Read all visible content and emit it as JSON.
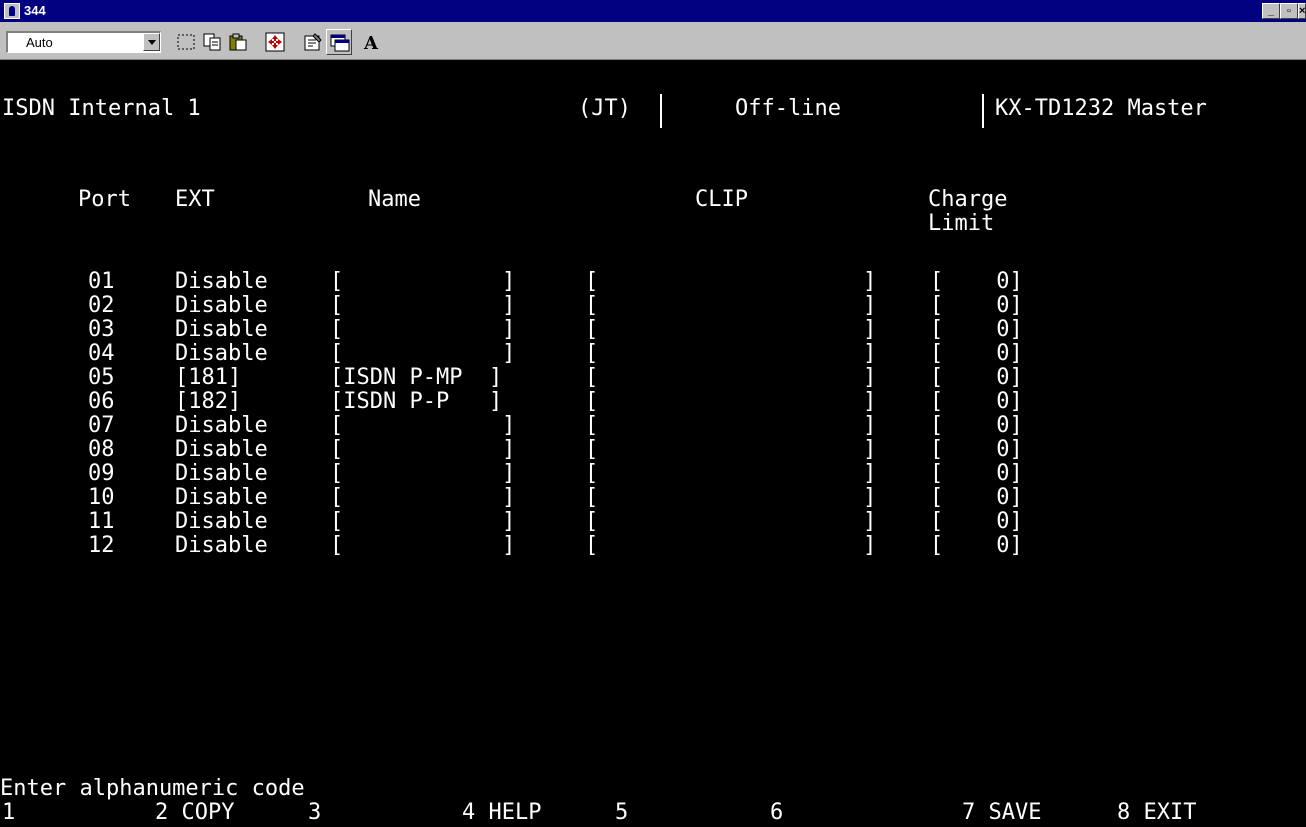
{
  "window": {
    "title": "344"
  },
  "toolbar": {
    "font_size_value": "Auto"
  },
  "header": {
    "screen_title": "ISDN Internal 1",
    "jt": "(JT)",
    "status": "Off-line",
    "model": "KX-TD1232 Master"
  },
  "columns": {
    "port": "Port",
    "ext": "EXT",
    "name": "Name",
    "clip": "CLIP",
    "charge": "Charge",
    "limit": "Limit"
  },
  "rows": [
    {
      "port": "01",
      "ext": "Disable",
      "name": "[            ]",
      "clip": "[                    ]",
      "charge": "[    0]"
    },
    {
      "port": "02",
      "ext": "Disable",
      "name": "[            ]",
      "clip": "[                    ]",
      "charge": "[    0]"
    },
    {
      "port": "03",
      "ext": "Disable",
      "name": "[            ]",
      "clip": "[                    ]",
      "charge": "[    0]"
    },
    {
      "port": "04",
      "ext": "Disable",
      "name": "[            ]",
      "clip": "[                    ]",
      "charge": "[    0]"
    },
    {
      "port": "05",
      "ext": "[181]",
      "name": "[ISDN P-MP  ]",
      "clip": "[                    ]",
      "charge": "[    0]"
    },
    {
      "port": "06",
      "ext": "[182]",
      "name": "[ISDN P-P   ]",
      "clip": "[                    ]",
      "charge": "[    0]"
    },
    {
      "port": "07",
      "ext": "Disable",
      "name": "[            ]",
      "clip": "[                    ]",
      "charge": "[    0]"
    },
    {
      "port": "08",
      "ext": "Disable",
      "name": "[            ]",
      "clip": "[                    ]",
      "charge": "[    0]"
    },
    {
      "port": "09",
      "ext": "Disable",
      "name": "[            ]",
      "clip": "[                    ]",
      "charge": "[    0]"
    },
    {
      "port": "10",
      "ext": "Disable",
      "name": "[            ]",
      "clip": "[                    ]",
      "charge": "[    0]"
    },
    {
      "port": "11",
      "ext": "Disable",
      "name": "[            ]",
      "clip": "[                    ]",
      "charge": "[    0]"
    },
    {
      "port": "12",
      "ext": "Disable",
      "name": "[            ]",
      "clip": "[                    ]",
      "charge": "[    0]"
    }
  ],
  "prompt": "Enter alphanumeric code",
  "function_keys": [
    {
      "num": "1",
      "label": ""
    },
    {
      "num": "2",
      "label": "COPY"
    },
    {
      "num": "3",
      "label": ""
    },
    {
      "num": "4",
      "label": "HELP"
    },
    {
      "num": "5",
      "label": ""
    },
    {
      "num": "6",
      "label": ""
    },
    {
      "num": "7",
      "label": "SAVE"
    },
    {
      "num": "8",
      "label": "EXIT"
    }
  ]
}
